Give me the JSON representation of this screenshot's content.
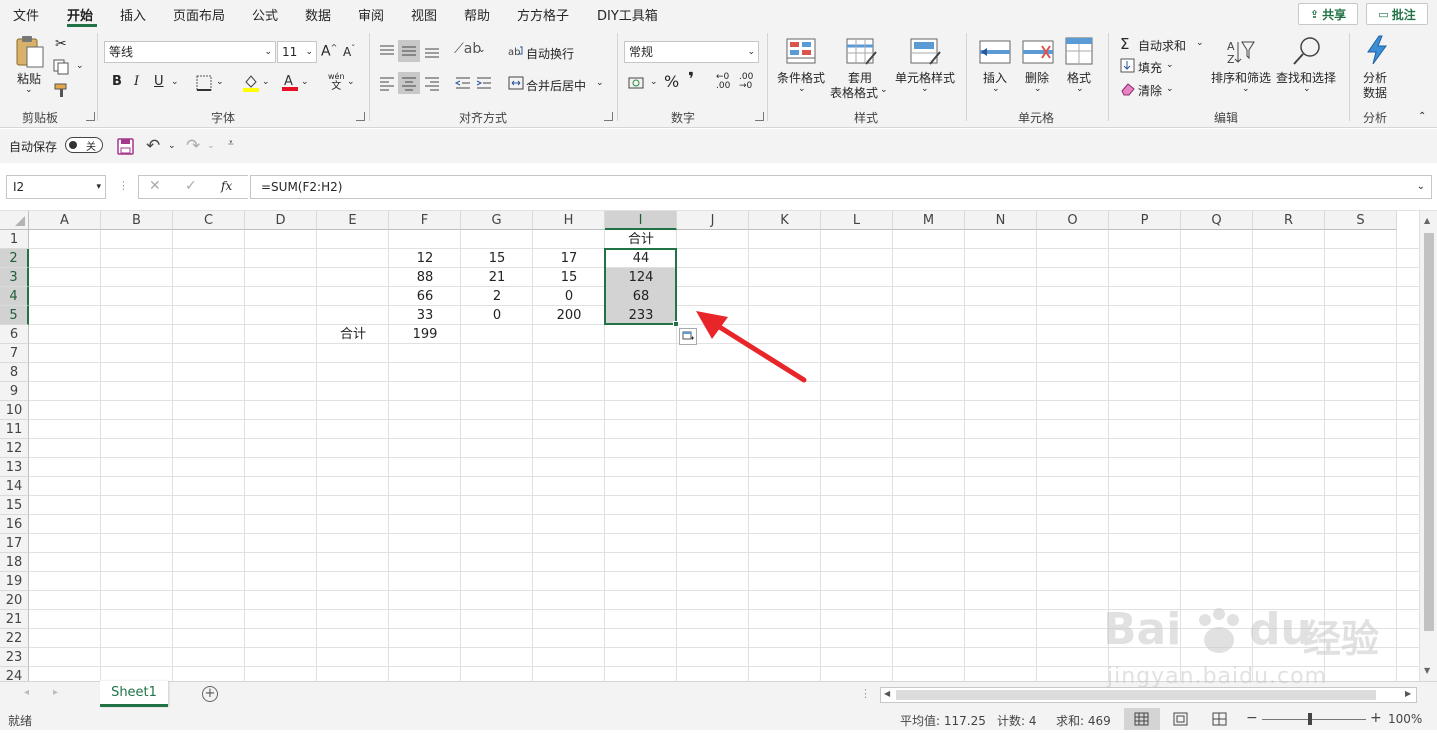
{
  "menu": {
    "items": [
      "文件",
      "开始",
      "插入",
      "页面布局",
      "公式",
      "数据",
      "审阅",
      "视图",
      "帮助",
      "方方格子",
      "DIY工具箱"
    ],
    "active_index": 1,
    "share_label": "共享",
    "comment_label": "批注"
  },
  "ribbon": {
    "clipboard": {
      "paste": "粘贴",
      "group": "剪贴板"
    },
    "font": {
      "name": "等线",
      "size": "11",
      "group": "字体",
      "bold": "B",
      "italic": "I",
      "underline": "U",
      "grow": "A",
      "shrink": "A",
      "phonetic_top": "wén",
      "phonetic_bottom": "文"
    },
    "alignment": {
      "wrap": "自动换行",
      "merge": "合并后居中",
      "group": "对齐方式"
    },
    "number": {
      "format": "常规",
      "percent": "%",
      "comma": "❜",
      "group": "数字"
    },
    "styles": {
      "conditional": "条件格式",
      "table_line1": "套用",
      "table_line2": "表格格式",
      "cell_styles": "单元格样式",
      "group": "样式"
    },
    "cells": {
      "insert": "插入",
      "delete": "删除",
      "format": "格式",
      "group": "单元格"
    },
    "editing": {
      "autosum": "自动求和",
      "fill": "填充",
      "clear": "清除",
      "sort": "排序和筛选",
      "find": "查找和选择",
      "group": "编辑"
    },
    "analysis": {
      "line1": "分析",
      "line2": "数据",
      "group": "分析"
    }
  },
  "qat": {
    "autosave_label": "自动保存",
    "toggle_state": "关"
  },
  "formula_bar": {
    "name_box": "I2",
    "fx": "fx",
    "formula": "=SUM(F2:H2)"
  },
  "columns": [
    "A",
    "B",
    "C",
    "D",
    "E",
    "F",
    "G",
    "H",
    "I",
    "J",
    "K",
    "L",
    "M",
    "N",
    "O",
    "P",
    "Q",
    "R",
    "S"
  ],
  "rows": [
    "1",
    "2",
    "3",
    "4",
    "5",
    "6",
    "7",
    "8",
    "9",
    "10",
    "11",
    "12",
    "13",
    "14",
    "15",
    "16",
    "17",
    "18",
    "19",
    "20",
    "21",
    "22",
    "23",
    "24"
  ],
  "selected_column": "I",
  "selected_rows": [
    "2",
    "3",
    "4",
    "5"
  ],
  "cells": [
    {
      "ref": "I1",
      "col": "I",
      "row": "1",
      "value": "合计"
    },
    {
      "ref": "F2",
      "col": "F",
      "row": "2",
      "value": "12"
    },
    {
      "ref": "G2",
      "col": "G",
      "row": "2",
      "value": "15"
    },
    {
      "ref": "H2",
      "col": "H",
      "row": "2",
      "value": "17"
    },
    {
      "ref": "I2",
      "col": "I",
      "row": "2",
      "value": "44"
    },
    {
      "ref": "F3",
      "col": "F",
      "row": "3",
      "value": "88"
    },
    {
      "ref": "G3",
      "col": "G",
      "row": "3",
      "value": "21"
    },
    {
      "ref": "H3",
      "col": "H",
      "row": "3",
      "value": "15"
    },
    {
      "ref": "I3",
      "col": "I",
      "row": "3",
      "value": "124"
    },
    {
      "ref": "F4",
      "col": "F",
      "row": "4",
      "value": "66"
    },
    {
      "ref": "G4",
      "col": "G",
      "row": "4",
      "value": "2"
    },
    {
      "ref": "H4",
      "col": "H",
      "row": "4",
      "value": "0"
    },
    {
      "ref": "I4",
      "col": "I",
      "row": "4",
      "value": "68"
    },
    {
      "ref": "F5",
      "col": "F",
      "row": "5",
      "value": "33"
    },
    {
      "ref": "G5",
      "col": "G",
      "row": "5",
      "value": "0"
    },
    {
      "ref": "H5",
      "col": "H",
      "row": "5",
      "value": "200"
    },
    {
      "ref": "I5",
      "col": "I",
      "row": "5",
      "value": "233"
    },
    {
      "ref": "E6",
      "col": "E",
      "row": "6",
      "value": "合计"
    },
    {
      "ref": "F6",
      "col": "F",
      "row": "6",
      "value": "199"
    }
  ],
  "sheet_tab": "Sheet1",
  "status": {
    "ready": "就绪",
    "average": "平均值: 117.25",
    "count": "计数: 4",
    "sum": "求和: 469",
    "zoom": "100%"
  },
  "watermark": {
    "brand": "Bai",
    "brand_suffix": "du",
    "cn": "经验",
    "url": "jingyan.baidu.com"
  },
  "colors": {
    "accent": "#217346",
    "arrow": "#e8262a",
    "selection_fill": "#d3d3d3"
  }
}
